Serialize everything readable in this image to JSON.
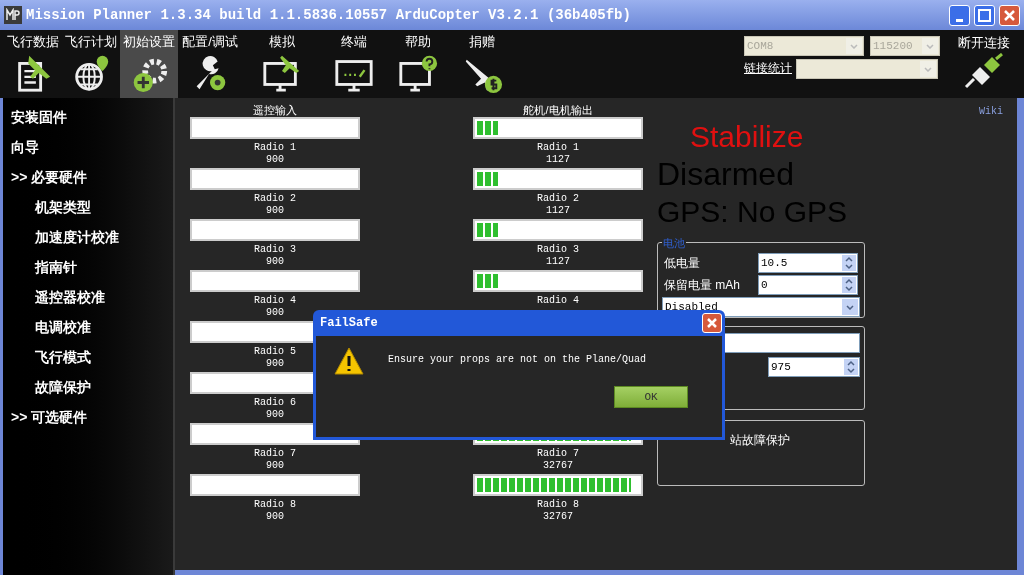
{
  "window": {
    "title": "Mission Planner 1.3.34 build 1.1.5836.10557 ArduCopter V3.2.1 (36b405fb)"
  },
  "toolbar": [
    {
      "label": "飞行数据",
      "selected": false
    },
    {
      "label": "飞行计划",
      "selected": false
    },
    {
      "label": "初始设置",
      "selected": true
    },
    {
      "label": "配置/调试",
      "selected": false
    },
    {
      "label": "模拟",
      "selected": false
    },
    {
      "label": "终端",
      "selected": false
    },
    {
      "label": "帮助",
      "selected": false
    },
    {
      "label": "捐赠",
      "selected": false
    }
  ],
  "connection": {
    "port": "COM8",
    "baud": "115200",
    "link_stats": "链接统计",
    "disconnect": "断开连接"
  },
  "sidebar": {
    "items": [
      {
        "label": "安装固件",
        "kind": "top"
      },
      {
        "label": "向导",
        "kind": "top"
      },
      {
        "label": ">> 必要硬件",
        "kind": "top"
      },
      {
        "label": "机架类型",
        "kind": "sub"
      },
      {
        "label": "加速度计校准",
        "kind": "sub"
      },
      {
        "label": "指南针",
        "kind": "sub"
      },
      {
        "label": "遥控器校准",
        "kind": "sub"
      },
      {
        "label": "电调校准",
        "kind": "sub"
      },
      {
        "label": "飞行模式",
        "kind": "sub"
      },
      {
        "label": "故障保护",
        "kind": "sub"
      },
      {
        "label": ">> 可选硬件",
        "kind": "top"
      }
    ]
  },
  "radio_in": {
    "title": "遥控输入",
    "channels": [
      {
        "name": "Radio 1",
        "value": "900"
      },
      {
        "name": "Radio 2",
        "value": "900"
      },
      {
        "name": "Radio 3",
        "value": "900"
      },
      {
        "name": "Radio 4",
        "value": "900"
      },
      {
        "name": "Radio 5",
        "value": "900"
      },
      {
        "name": "Radio 6",
        "value": "900"
      },
      {
        "name": "Radio 7",
        "value": "900"
      },
      {
        "name": "Radio 8",
        "value": "900"
      }
    ]
  },
  "servo_out": {
    "title": "舵机/电机输出",
    "channels": [
      {
        "kind": "channel",
        "name": "Radio 1",
        "value": "1127",
        "level": 0.13
      },
      {
        "kind": "channel",
        "name": "Radio 2",
        "value": "1127",
        "level": 0.13
      },
      {
        "kind": "channel",
        "name": "Radio 3",
        "value": "1127",
        "level": 0.13
      },
      {
        "kind": "channel",
        "name": "Radio 4",
        "level": 0.13
      },
      {
        "kind": "covered"
      },
      {
        "kind": "covered"
      },
      {
        "kind": "channel",
        "name": "Radio 7",
        "value": "32767",
        "level": 0.95
      },
      {
        "kind": "channel",
        "name": "Radio 8",
        "value": "32767",
        "level": 0.95
      }
    ]
  },
  "wiki_link": "Wiki",
  "status": {
    "mode": "Stabilize",
    "armed": "Disarmed",
    "gps": "GPS: No GPS"
  },
  "battery": {
    "title": "电池",
    "low_voltage_label": "低电量",
    "low_voltage": "10.5",
    "reserve_label": "保留电量 mAh",
    "reserve": "0",
    "action": "Disabled"
  },
  "radio_failsafe": {
    "pwm": "975"
  },
  "gcs_failsafe": {
    "label": "站故障保护"
  },
  "dialog": {
    "title": "FailSafe",
    "message": "Ensure your props are not on the Plane/Quad",
    "ok": "OK"
  }
}
